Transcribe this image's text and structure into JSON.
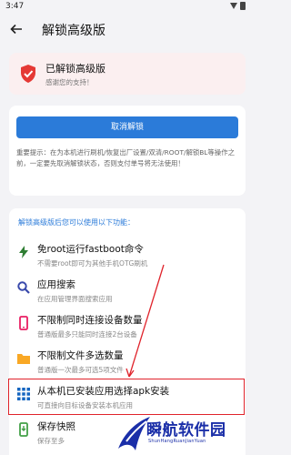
{
  "status_bar": {
    "time": "3:47"
  },
  "app_bar": {
    "title": "解锁高级版"
  },
  "unlock_card": {
    "title": "已解锁高级版",
    "subtitle": "感谢您的支持！"
  },
  "action_card": {
    "cancel_label": "取消解锁",
    "notice": "重要提示：在为本机进行刷机/恢复出厂设置/双清/ROOT/解锁BL等操作之前，一定要先取消解锁状态，否则支付单号将无法使用！"
  },
  "features": {
    "header": "解锁高级版后您可以使用以下功能：",
    "items": [
      {
        "title": "免root运行fastboot命令",
        "desc": "不需要root即可为其他手机OTG刷机",
        "icon": "lightning-icon",
        "color": "#2e7d32"
      },
      {
        "title": "应用搜索",
        "desc": "在应用管理界面搜索应用",
        "icon": "search-icon",
        "color": "#3949ab"
      },
      {
        "title": "不限制同时连接设备数量",
        "desc": "普通版最多只能同时连接2台设备",
        "icon": "phone-icon",
        "color": "#e91e63"
      },
      {
        "title": "不限制文件多选数量",
        "desc": "普通版一次最多可选5项文件",
        "icon": "folder-icon",
        "color": "#f9a825"
      },
      {
        "title": "从本机已安装应用选择apk安装",
        "desc": "可直接向目标设备安装本机应用",
        "icon": "apps-grid-icon",
        "color": "#1565c0"
      },
      {
        "title": "保存快照",
        "desc": "保存至多",
        "icon": "phone-save-icon",
        "color": "#43a047"
      }
    ]
  },
  "watermark": {
    "text": "瞬航软件园",
    "url": "ShunHangRuanJianYuan"
  }
}
